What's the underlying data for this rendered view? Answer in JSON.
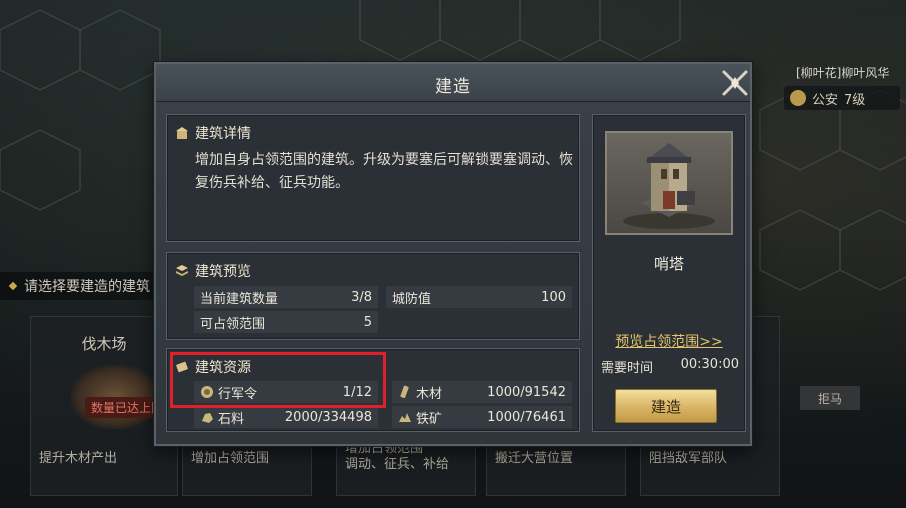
{
  "background": {
    "top_right_text": "[柳叶花]柳叶风华",
    "security": {
      "label": "公安",
      "level": "7级"
    },
    "select_hint": "请选择要建造的建筑",
    "cards": [
      {
        "title": "伐木场",
        "desc": "提升木材产出",
        "badge": "数量已达上限"
      },
      {
        "title": "",
        "desc": "增加占领范围"
      },
      {
        "title": "",
        "desc": "增加占领范围\n调动、征兵、补给"
      },
      {
        "title": "",
        "desc": "搬迁大营位置"
      },
      {
        "title": "",
        "desc": "阻挡敌军部队"
      }
    ],
    "right_button": "拒马"
  },
  "dialog": {
    "title": "建造",
    "details": {
      "heading": "建筑详情",
      "description": "增加自身占领范围的建筑。升级为要塞后可解锁要塞调动、恢复伤兵补给、征兵功能。"
    },
    "preview": {
      "heading": "建筑预览",
      "rows": [
        {
          "label": "当前建筑数量",
          "value": "3/8"
        },
        {
          "label": "城防值",
          "value": "100"
        },
        {
          "label": "可占领范围",
          "value": "5"
        }
      ]
    },
    "resources": {
      "heading": "建筑资源",
      "items": [
        {
          "label": "行军令",
          "value": "1/12",
          "icon": "march-order-icon"
        },
        {
          "label": "木材",
          "value": "1000/91542",
          "icon": "wood-icon"
        },
        {
          "label": "石料",
          "value": "2000/334498",
          "icon": "stone-icon"
        },
        {
          "label": "铁矿",
          "value": "1000/76461",
          "icon": "iron-icon"
        }
      ]
    },
    "side": {
      "building_name": "哨塔",
      "preview_link": "预览占领范围>>",
      "time_label": "需要时间",
      "time_value": "00:30:00",
      "build_button": "建造"
    }
  },
  "colors": {
    "accent_gold": "#e5c36b",
    "highlight_red": "#e0202a",
    "panel_bg": "#2a3035"
  }
}
